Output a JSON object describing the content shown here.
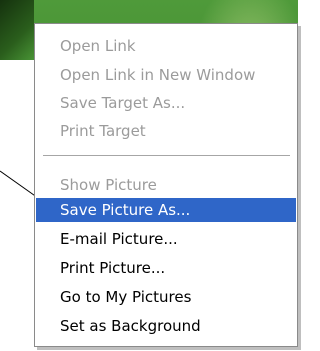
{
  "context_menu": {
    "group_link": [
      {
        "label": "Open Link",
        "enabled": false
      },
      {
        "label": "Open Link in New Window",
        "enabled": false
      },
      {
        "label": "Save Target As...",
        "enabled": false
      },
      {
        "label": "Print Target",
        "enabled": false
      }
    ],
    "group_picture": [
      {
        "label": "Show Picture",
        "enabled": false
      },
      {
        "label": "Save Picture As...",
        "enabled": true,
        "highlighted": true
      },
      {
        "label": "E-mail Picture...",
        "enabled": true
      },
      {
        "label": "Print Picture...",
        "enabled": true
      },
      {
        "label": "Go to My Pictures",
        "enabled": true
      },
      {
        "label": "Set as Background",
        "enabled": true
      }
    ]
  },
  "colors": {
    "highlight": "#2f66c8",
    "disabled_text": "#9b9b9b",
    "background_image_green": "#3f8a2e"
  }
}
